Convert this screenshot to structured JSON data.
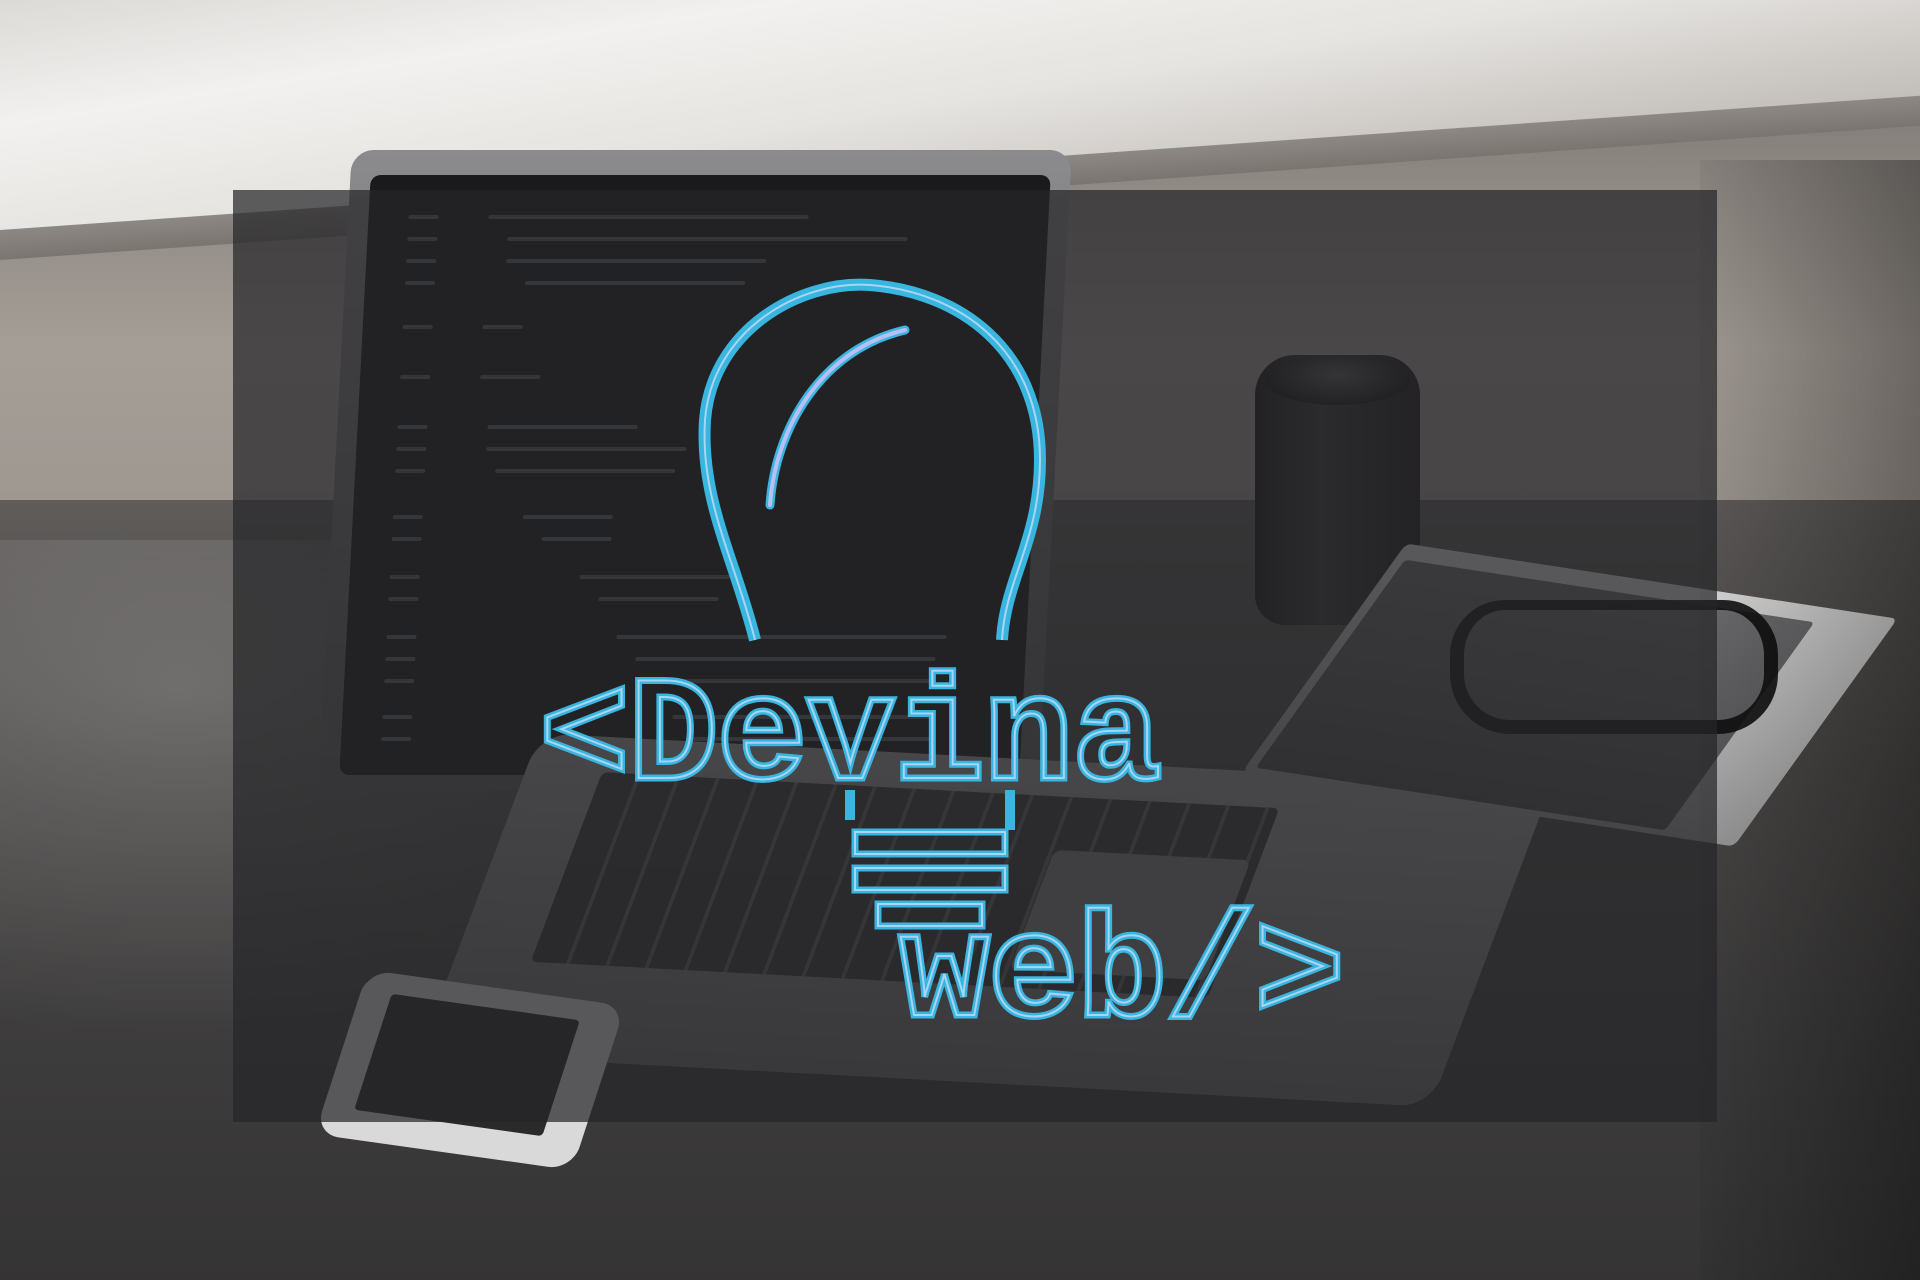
{
  "logo": {
    "line1": "<Devina",
    "line2": "web/>",
    "icon": "lightbulb-icon",
    "colors": {
      "primary_stroke": "#38b6df",
      "highlight_stroke": "#a9d4f5",
      "overlay": "#262528"
    }
  },
  "background": {
    "description_icon": "laptop-desk-photo"
  }
}
